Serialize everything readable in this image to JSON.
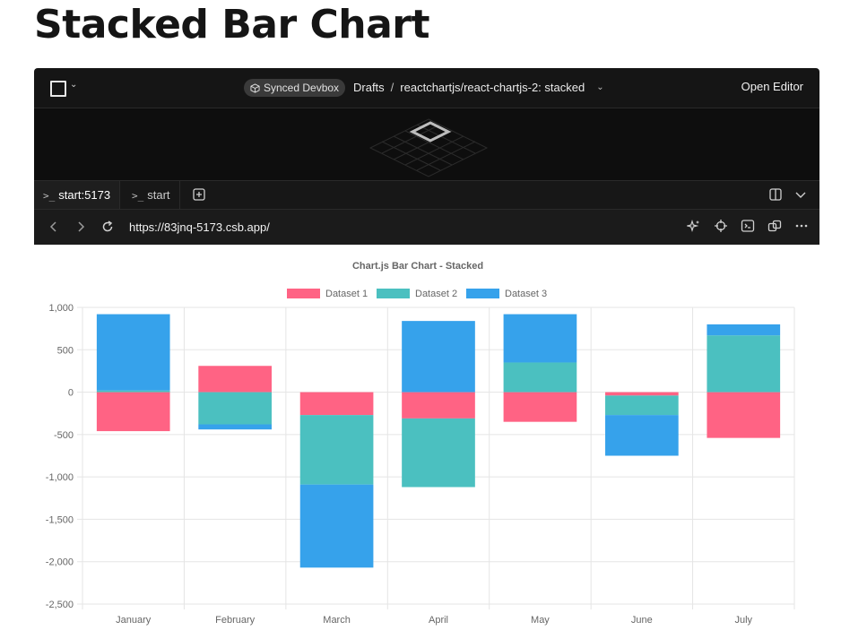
{
  "page": {
    "title": "Stacked Bar Chart"
  },
  "topbar": {
    "devbox_label": "Synced Devbox",
    "breadcrumb": [
      "Drafts",
      "/",
      "reactchartjs/react-chartjs-2: stacked"
    ],
    "open_editor_label": "Open Editor"
  },
  "tabs": [
    {
      "label": "start:5173",
      "active": true
    },
    {
      "label": "start",
      "active": false
    }
  ],
  "urlbar": {
    "url": "https://83jnq-5173.csb.app/"
  },
  "icons": {
    "menu": "square-icon",
    "devbox": "cube-icon",
    "logo": "grid-diamond-icon",
    "terminal": "terminal-icon",
    "add_tab": "plus-square-icon",
    "split": "split-view-icon",
    "back": "chevron-left-icon",
    "forward": "chevron-right-icon",
    "reload": "reload-icon",
    "sparkle": "sparkle-icon",
    "target": "crosshair-icon",
    "console": "console-icon",
    "popout": "popout-icon",
    "more": "more-icon"
  },
  "chart_data": {
    "type": "bar",
    "stacked": true,
    "title": "Chart.js Bar Chart - Stacked",
    "categories": [
      "January",
      "February",
      "March",
      "April",
      "May",
      "June",
      "July"
    ],
    "series": [
      {
        "name": "Dataset 1",
        "color": "#ff6384",
        "values": [
          -460,
          310,
          -270,
          -310,
          -350,
          -40,
          -540
        ]
      },
      {
        "name": "Dataset 2",
        "color": "#4bc0c0",
        "values": [
          20,
          -380,
          -820,
          -810,
          350,
          -230,
          670
        ]
      },
      {
        "name": "Dataset 3",
        "color": "#36a2eb",
        "values": [
          900,
          -60,
          -980,
          840,
          570,
          -480,
          130
        ]
      }
    ],
    "ylim": [
      -2500,
      1000
    ],
    "yticks": [
      "1,000",
      "500",
      "0",
      "-500",
      "-1,000",
      "-1,500",
      "-2,000",
      "-2,500"
    ],
    "ytick_values": [
      1000,
      500,
      0,
      -500,
      -1000,
      -1500,
      -2000,
      -2500
    ],
    "grid": true,
    "legend_position": "top"
  }
}
